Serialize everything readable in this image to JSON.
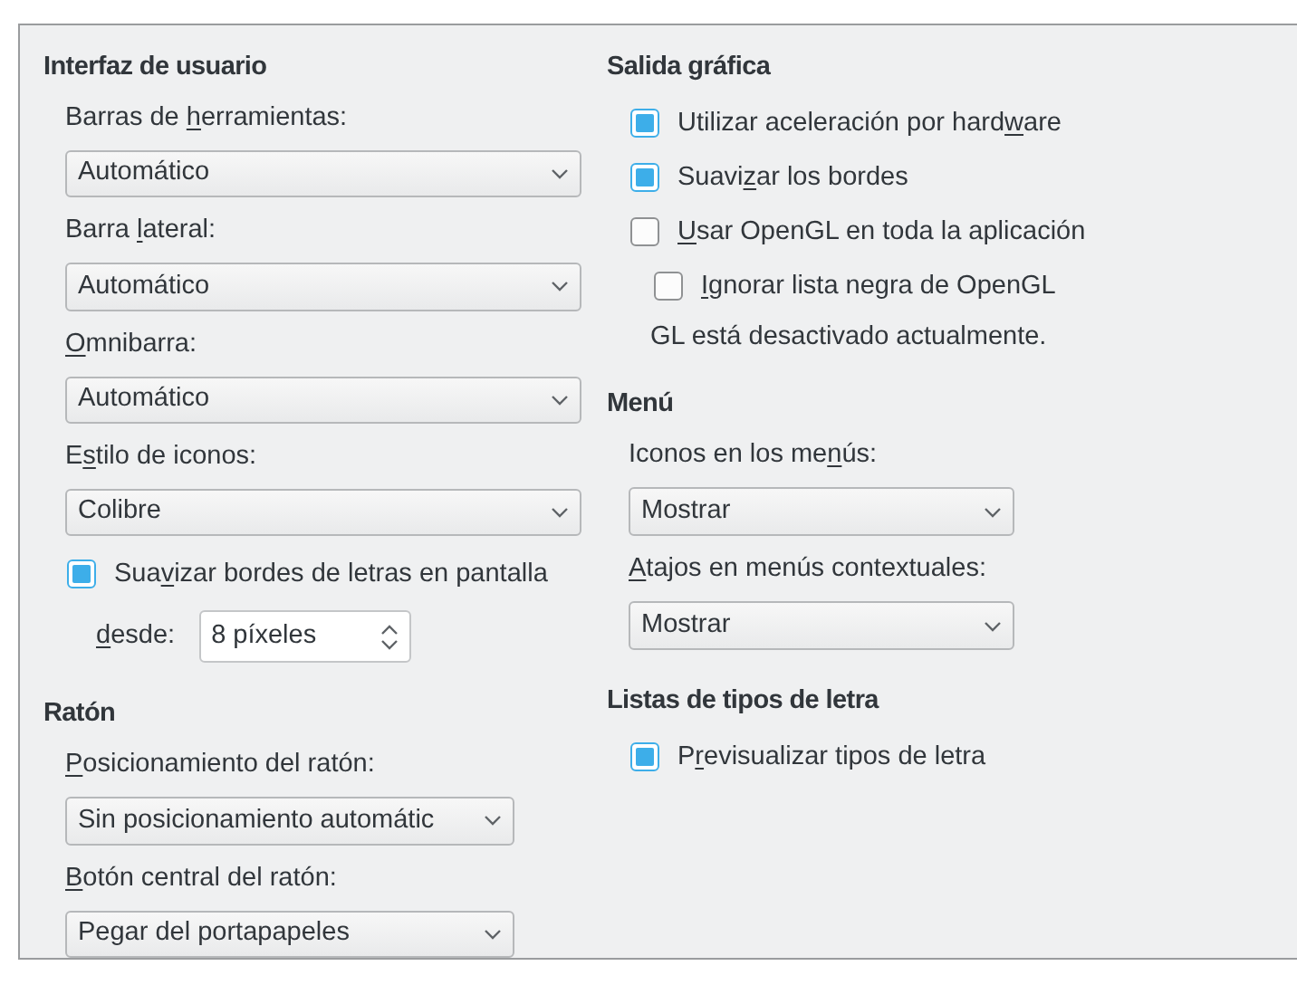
{
  "columns": [
    {
      "sections": [
        {
          "title": "Interfaz de usuario",
          "items": [
            {
              "kind": "dropdown",
              "label": {
                "before": "Barras de ",
                "key": "h",
                "after": "erramientas:"
              },
              "value": "Automático"
            },
            {
              "kind": "dropdown",
              "label": {
                "before": "Barra ",
                "key": "l",
                "after": "ateral:"
              },
              "value": "Automático"
            },
            {
              "kind": "dropdown",
              "label": {
                "key": "O",
                "after": "mnibarra:"
              },
              "value": "Automático"
            },
            {
              "kind": "dropdown",
              "label": {
                "before": "E",
                "key": "s",
                "after": "tilo de iconos:"
              },
              "value": "Colibre"
            },
            {
              "kind": "checkbox",
              "label": {
                "before": "Sua",
                "key": "v",
                "after": "izar bordes de letras en pantalla"
              },
              "checked": true
            },
            {
              "kind": "spin",
              "label": {
                "key": "d",
                "after": "esde:"
              },
              "value": "8 píxeles"
            }
          ]
        },
        {
          "title": "Ratón",
          "items": [
            {
              "kind": "dropdown",
              "label": {
                "key": "P",
                "after": "osicionamiento del ratón:"
              },
              "value": "Sin posicionamiento automátic"
            },
            {
              "kind": "dropdown",
              "label": {
                "key": "B",
                "after": "otón central del ratón:"
              },
              "value": "Pegar del portapapeles"
            }
          ]
        }
      ]
    },
    {
      "sections": [
        {
          "title": "Salida gráfica",
          "items": [
            {
              "kind": "checkbox",
              "label": {
                "before": "Utilizar aceleración por hard",
                "key": "w",
                "after": "are"
              },
              "checked": true
            },
            {
              "kind": "checkbox",
              "label": {
                "before": "Suavi",
                "key": "z",
                "after": "ar los bordes"
              },
              "checked": true
            },
            {
              "kind": "checkbox",
              "label": {
                "key": "U",
                "after": "sar OpenGL en toda la aplicación"
              },
              "checked": false,
              "children": [
                {
                  "kind": "checkbox",
                  "label": {
                    "key": "I",
                    "after": "gnorar lista negra de OpenGL"
                  },
                  "checked": false
                }
              ]
            },
            {
              "kind": "note",
              "text": "GL está desactivado actualmente."
            }
          ]
        },
        {
          "title": "Menú",
          "items": [
            {
              "kind": "dropdown",
              "label": {
                "before": "Iconos en los me",
                "key": "n",
                "after": "ús:"
              },
              "value": "Mostrar"
            },
            {
              "kind": "dropdown",
              "label": {
                "key": "A",
                "after": "tajos en menús contextuales:"
              },
              "value": "Mostrar"
            }
          ]
        },
        {
          "title": "Listas de tipos de letra",
          "items": [
            {
              "kind": "checkbox",
              "label": {
                "before": "P",
                "key": "r",
                "after": "evisualizar tipos de letra"
              },
              "checked": true
            }
          ]
        }
      ]
    }
  ]
}
